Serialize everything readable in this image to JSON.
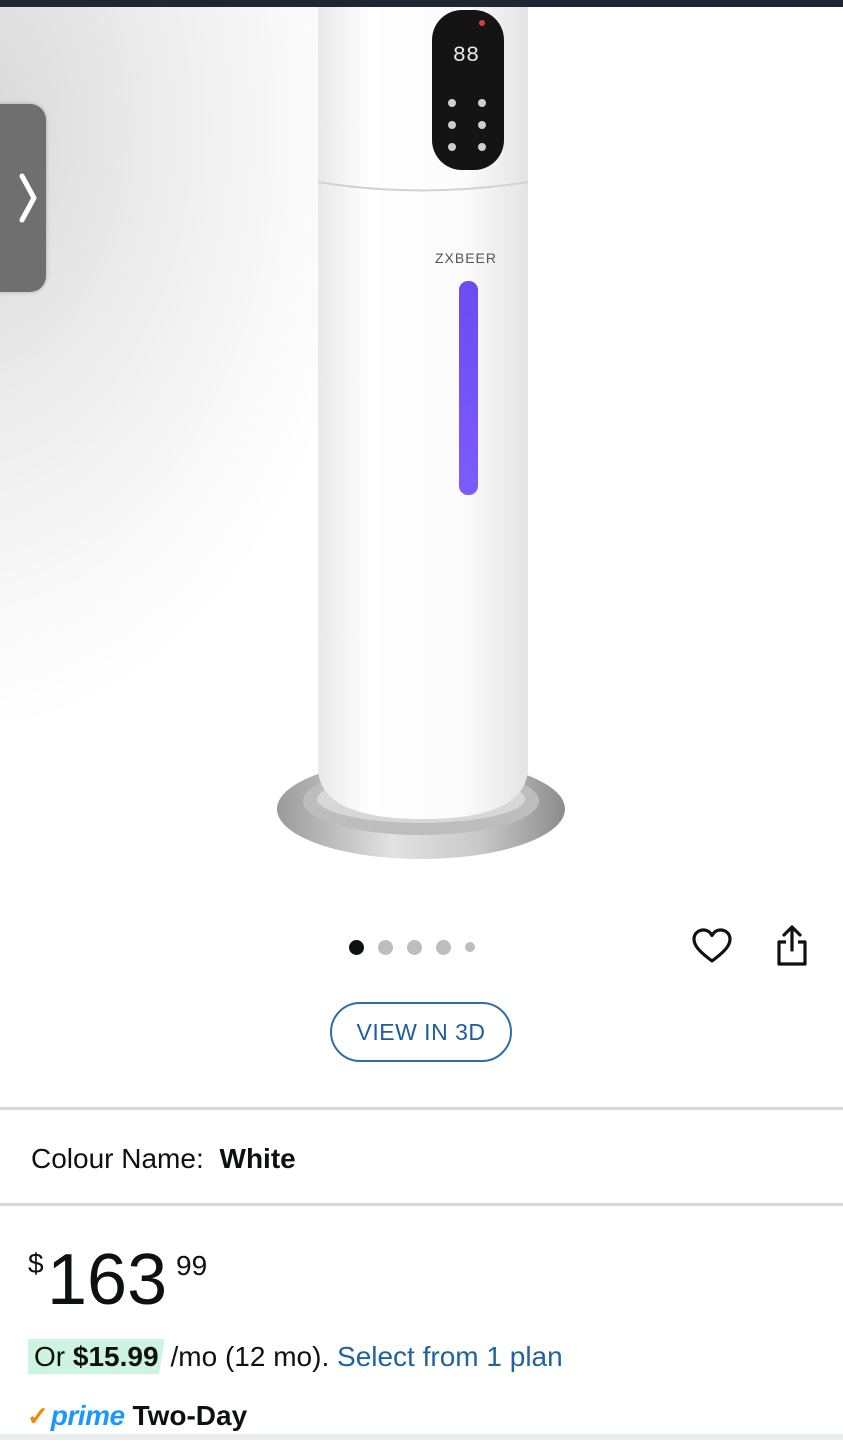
{
  "gallery": {
    "product_brand_on_image": "ZXBEER",
    "image_count": 5,
    "current_image": 1
  },
  "actions": {
    "view_3d_label": "VIEW IN 3D"
  },
  "variation": {
    "label": "Colour Name:",
    "value": "White"
  },
  "price": {
    "symbol": "$",
    "whole": "163",
    "fraction": "99"
  },
  "installment": {
    "prefix": "Or",
    "amount": "$15.99",
    "terms": "/mo (12 mo).",
    "link": "Select from 1 plan"
  },
  "delivery": {
    "check": "✓",
    "prime_label": "prime",
    "speed": "Two-Day"
  },
  "colors": {
    "link": "#2162a1",
    "prime_blue": "#1a98ff",
    "installment_highlight": "#cdf3e1",
    "button_border": "#2e6ea8"
  },
  "icons": [
    "chevron-right-icon",
    "heart-icon",
    "share-icon"
  ]
}
